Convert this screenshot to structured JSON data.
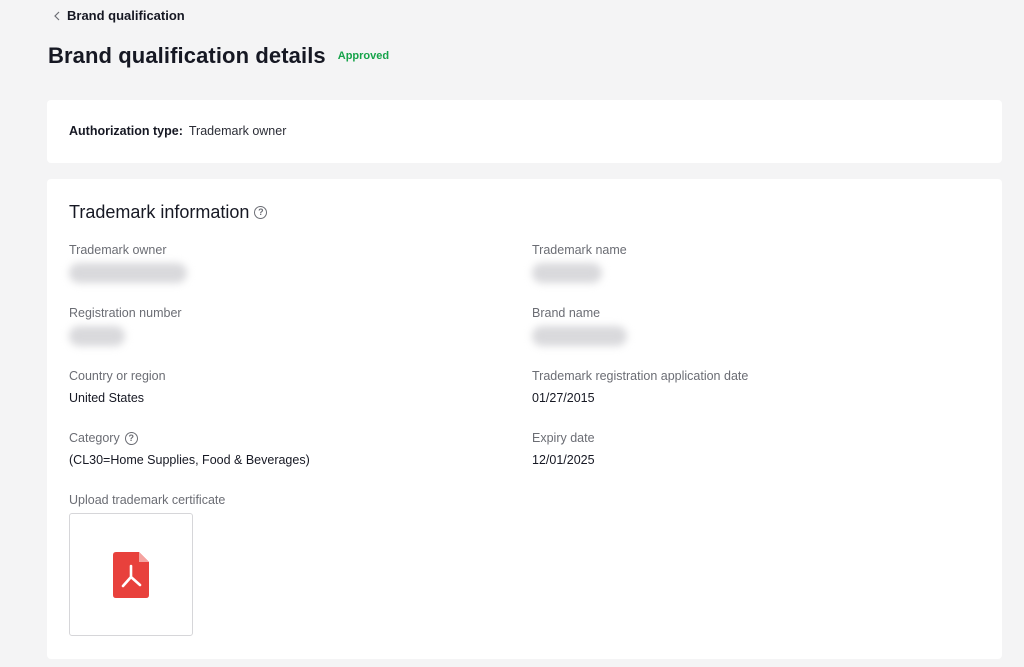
{
  "header": {
    "back_label": "Brand qualification",
    "title": "Brand qualification details",
    "status": "Approved",
    "status_color": "#16a34a"
  },
  "authorization": {
    "label": "Authorization type:",
    "value": "Trademark owner"
  },
  "trademark": {
    "section_title": "Trademark information",
    "fields": {
      "owner": {
        "label": "Trademark owner",
        "value": ""
      },
      "name": {
        "label": "Trademark name",
        "value": ""
      },
      "registration_number": {
        "label": "Registration number",
        "value": ""
      },
      "brand_name": {
        "label": "Brand name",
        "value": ""
      },
      "country": {
        "label": "Country or region",
        "value": "United States"
      },
      "application_date": {
        "label": "Trademark registration application date",
        "value": "01/27/2015"
      },
      "category": {
        "label": "Category",
        "value": "(CL30=Home Supplies, Food & Beverages)"
      },
      "expiry": {
        "label": "Expiry date",
        "value": "12/01/2025"
      }
    },
    "upload_label": "Upload trademark certificate",
    "file_icon": "pdf-file-icon",
    "file_icon_color": "#e8413c"
  }
}
